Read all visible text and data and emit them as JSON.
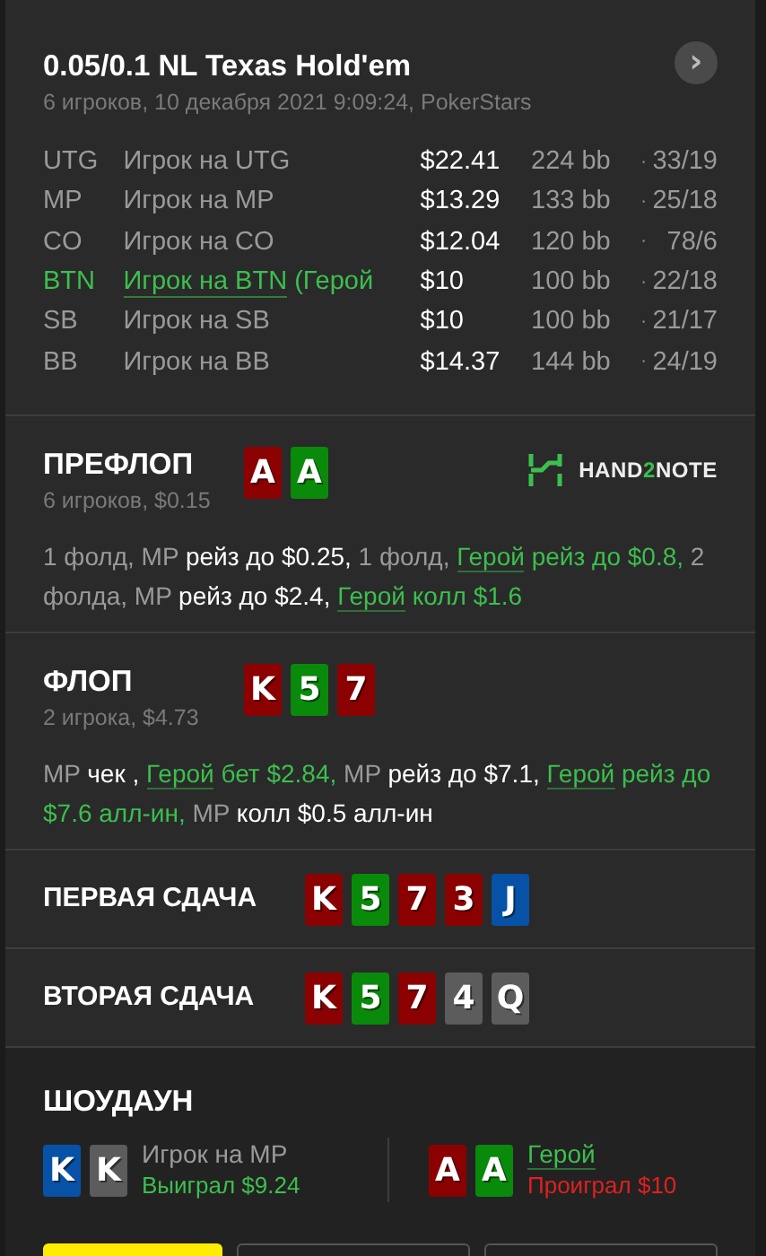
{
  "header": {
    "title": "0.05/0.1 NL Texas Hold'em",
    "subtitle": "6 игроков, 10 декабря 2021 9:09:24, PokerStars",
    "next_button": "›"
  },
  "players": [
    {
      "position": "UTG",
      "name": "Игрок на UTG",
      "stack": "$22.41",
      "bb": "224 bb",
      "stats": "33/19",
      "hero": false
    },
    {
      "position": "MP",
      "name": "Игрок на MP",
      "stack": "$13.29",
      "bb": "133 bb",
      "stats": "25/18",
      "hero": false
    },
    {
      "position": "CO",
      "name": "Игрок на CO",
      "stack": "$12.04",
      "bb": "120 bb",
      "stats": "78/6",
      "hero": false
    },
    {
      "position": "BTN",
      "name": "Игрок на BTN",
      "note": "(Герой",
      "stack": "$10",
      "bb": "100 bb",
      "stats": "22/18",
      "hero": true
    },
    {
      "position": "SB",
      "name": "Игрок на SB",
      "stack": "$10",
      "bb": "100 bb",
      "stats": "21/17",
      "hero": false
    },
    {
      "position": "BB",
      "name": "Игрок на BB",
      "stack": "$14.37",
      "bb": "144 bb",
      "stats": "24/19",
      "hero": false
    }
  ],
  "separator": "·",
  "streets": [
    {
      "title": "ПРЕФЛОП",
      "subtitle": "6 игроков, $0.15",
      "logo": {
        "before": "HAND",
        "accent": "2",
        "after": "NOTE"
      },
      "cards": [
        {
          "rank": "A",
          "color": "#8b0000"
        },
        {
          "rank": "A",
          "color": "#0a8a0a"
        }
      ],
      "actions": [
        {
          "kind": "muted",
          "text": "1 фолд, MP "
        },
        {
          "kind": "action",
          "text": "рейз до $0.25,"
        },
        {
          "kind": "muted",
          "text": " 1 фолд, "
        },
        {
          "kind": "hero-link",
          "text": "Герой"
        },
        {
          "kind": "hero",
          "text": " рейз до $0.8,"
        },
        {
          "kind": "muted",
          "text": " 2 фолда, MP "
        },
        {
          "kind": "action",
          "text": "рейз до $2.4, "
        },
        {
          "kind": "hero-link",
          "text": "Герой"
        },
        {
          "kind": "hero",
          "text": " колл $1.6"
        }
      ]
    },
    {
      "title": "ФЛОП",
      "subtitle": "2 игрока, $4.73",
      "cards": [
        {
          "rank": "K",
          "color": "#8b0000"
        },
        {
          "rank": "5",
          "color": "#0a8a0a"
        },
        {
          "rank": "7",
          "color": "#8b0000"
        }
      ],
      "actions": [
        {
          "kind": "muted",
          "text": "MP "
        },
        {
          "kind": "action",
          "text": "чек , "
        },
        {
          "kind": "hero-link",
          "text": "Герой"
        },
        {
          "kind": "hero",
          "text": " бет $2.84,"
        },
        {
          "kind": "muted",
          "text": " MP "
        },
        {
          "kind": "action",
          "text": "рейз до $7.1, "
        },
        {
          "kind": "hero-link",
          "text": "Герой"
        },
        {
          "kind": "hero",
          "text": " рейз до $7.6 алл-ин,"
        },
        {
          "kind": "muted",
          "text": " MP "
        },
        {
          "kind": "action",
          "text": "колл $0.5 алл-ин"
        }
      ]
    }
  ],
  "runs": [
    {
      "title": "ПЕРВАЯ СДАЧА",
      "cards": [
        {
          "rank": "K",
          "color": "#8b0000"
        },
        {
          "rank": "5",
          "color": "#0a8a0a"
        },
        {
          "rank": "7",
          "color": "#8b0000"
        },
        {
          "rank": "3",
          "color": "#8b0000"
        },
        {
          "rank": "J",
          "color": "#0752a6"
        }
      ]
    },
    {
      "title": "ВТОРАЯ СДАЧА",
      "cards": [
        {
          "rank": "K",
          "color": "#8b0000"
        },
        {
          "rank": "5",
          "color": "#0a8a0a"
        },
        {
          "rank": "7",
          "color": "#8b0000"
        },
        {
          "rank": "4",
          "color": "#5c5c5c"
        },
        {
          "rank": "Q",
          "color": "#5c5c5c"
        }
      ]
    }
  ],
  "showdown": {
    "title": "ШОУДАУН",
    "players": [
      {
        "name": "Игрок на MP",
        "result": "Выиграл $9.24",
        "won": true,
        "hero": false,
        "cards": [
          {
            "rank": "K",
            "color": "#0752a6"
          },
          {
            "rank": "K",
            "color": "#5c5c5c"
          }
        ]
      },
      {
        "name": "Герой",
        "result": "Проиграл $10",
        "won": false,
        "hero": true,
        "cards": [
          {
            "rank": "A",
            "color": "#8b0000"
          },
          {
            "rank": "A",
            "color": "#0a8a0a"
          }
        ]
      }
    ]
  },
  "buttons": [
    {
      "kind": "primary"
    },
    {
      "kind": "outline"
    },
    {
      "kind": "outline"
    }
  ]
}
